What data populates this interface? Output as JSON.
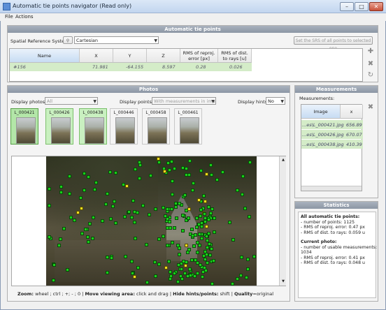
{
  "window": {
    "title": "Automatic tie points navigator (Read only)",
    "controls": [
      "–",
      "□",
      "✕"
    ]
  },
  "menu": {
    "file": "File",
    "actions": "Actions"
  },
  "atp": {
    "header": "Automatic tie points",
    "srs_label": "Spatial Reference System",
    "srs_icon_text": "⚲",
    "srs_value": "Cartesian",
    "set_srs_button": "Set the SRS of all points to selected one",
    "columns": [
      "Name",
      "X",
      "Y",
      "Z",
      "RMS of reproj. error [px]",
      "RMS of dist. to rays [u]"
    ],
    "row": [
      "#156",
      "71.981",
      "-64.155",
      "8.597",
      "0.28",
      "0.026"
    ],
    "side_icons": [
      "add-icon",
      "remove-icon",
      "refresh-icon"
    ]
  },
  "photos": {
    "header": "Photos",
    "display_photos_label": "Display photos:",
    "display_photos_value": "All",
    "display_points_label": "Display points:",
    "display_points_value": "With measurements in image",
    "display_hints_label": "Display hints:",
    "display_hints_value": "No",
    "thumbs": [
      {
        "label": "L_000421",
        "state": "selected-main"
      },
      {
        "label": "L_000426",
        "state": "selected"
      },
      {
        "label": "L_000438",
        "state": "selected"
      },
      {
        "label": "L_000446",
        "state": "normal"
      },
      {
        "label": "L_000458",
        "state": "normal"
      },
      {
        "label": "L_000461",
        "state": "normal"
      }
    ],
    "status": {
      "zoom_label": "Zoom:",
      "zoom_text": "wheel ; ctrl ; +; - ; 0 |",
      "move_label": "Move viewing area:",
      "move_text": "click and drag |",
      "hide_label": "Hide hints/points:",
      "hide_text": "shift |",
      "quality_label": "Quality",
      "quality_text": "=original"
    }
  },
  "measurements": {
    "header": "Measurements",
    "label": "Measurements:",
    "columns": [
      "Image",
      "x"
    ],
    "rows": [
      {
        "image": "...es\\L_000421.jpg",
        "x": "656.89"
      },
      {
        "image": "...es\\L_000426.jpg",
        "x": "670.07"
      },
      {
        "image": "...es\\L_000438.jpg",
        "x": "410.39"
      }
    ]
  },
  "statistics": {
    "header": "Statistics",
    "all_title": "All automatic tie points:",
    "all_lines": "- number of points: 1125\n- RMS of reproj. error: 0.47 px\n- RMS of dist. to rays: 0.059 u",
    "current_title": "Current photo:",
    "current_lines": "- number of usable measurements:\n1034\n- RMS of reproj. error: 0.41 px\n- RMS of dist. to rays: 0.048 u"
  },
  "colors": {
    "header": "#8b96a4",
    "point_green": "#18d018",
    "point_yellow": "#f0e020",
    "selected_row": "#d4ecc8"
  }
}
